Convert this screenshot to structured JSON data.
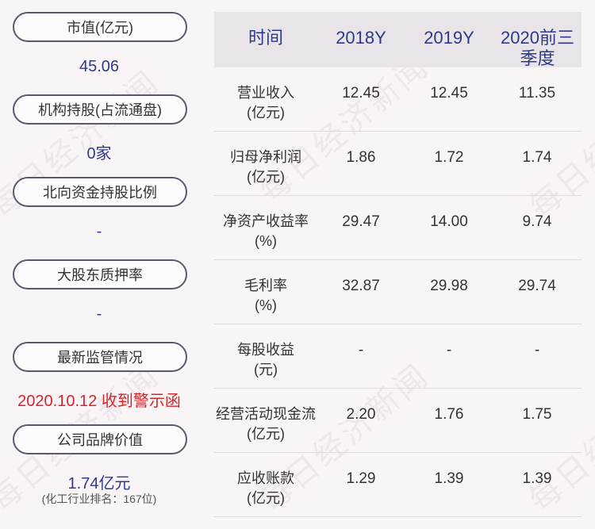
{
  "left": [
    {
      "label": "市值(亿元)",
      "value": "45.06"
    },
    {
      "label": "机构持股(占流通盘)",
      "value": "0家"
    },
    {
      "label": "北向资金持股比例",
      "value": "-"
    },
    {
      "label": "大股东质押率",
      "value": "-"
    },
    {
      "label": "最新监管情况",
      "value": "2020.10.12 收到警示函"
    },
    {
      "label": "公司品牌价值",
      "value": "1.74亿元",
      "sub": "(化工行业排名：167位)"
    }
  ],
  "table": {
    "headers": [
      "时间",
      "2018Y",
      "2019Y",
      "2020前三季度"
    ],
    "rows": [
      {
        "label1": "营业收入",
        "label2": "(亿元)",
        "values": [
          "12.45",
          "12.45",
          "11.35"
        ]
      },
      {
        "label1": "归母净利润",
        "label2": "(亿元)",
        "values": [
          "1.86",
          "1.72",
          "1.74"
        ]
      },
      {
        "label1": "净资产收益率",
        "label2": "(%)",
        "values": [
          "29.47",
          "14.00",
          "9.74"
        ]
      },
      {
        "label1": "毛利率",
        "label2": "(%)",
        "values": [
          "32.87",
          "29.98",
          "29.74"
        ]
      },
      {
        "label1": "每股收益",
        "label2": "(元)",
        "values": [
          "-",
          "-",
          "-"
        ]
      },
      {
        "label1": "经营活动现金流",
        "label2": "(亿元)",
        "values": [
          "2.20",
          "1.76",
          "1.75"
        ]
      },
      {
        "label1": "应收账款",
        "label2": "(亿元)",
        "values": [
          "1.29",
          "1.39",
          "1.39"
        ]
      }
    ]
  },
  "watermark": "每日经济新闻",
  "colors": {
    "accent": "#2d3a8c",
    "alert": "#d6262b",
    "header_bg": "#e8e4e8",
    "page_bg": "#f9f4f6"
  }
}
